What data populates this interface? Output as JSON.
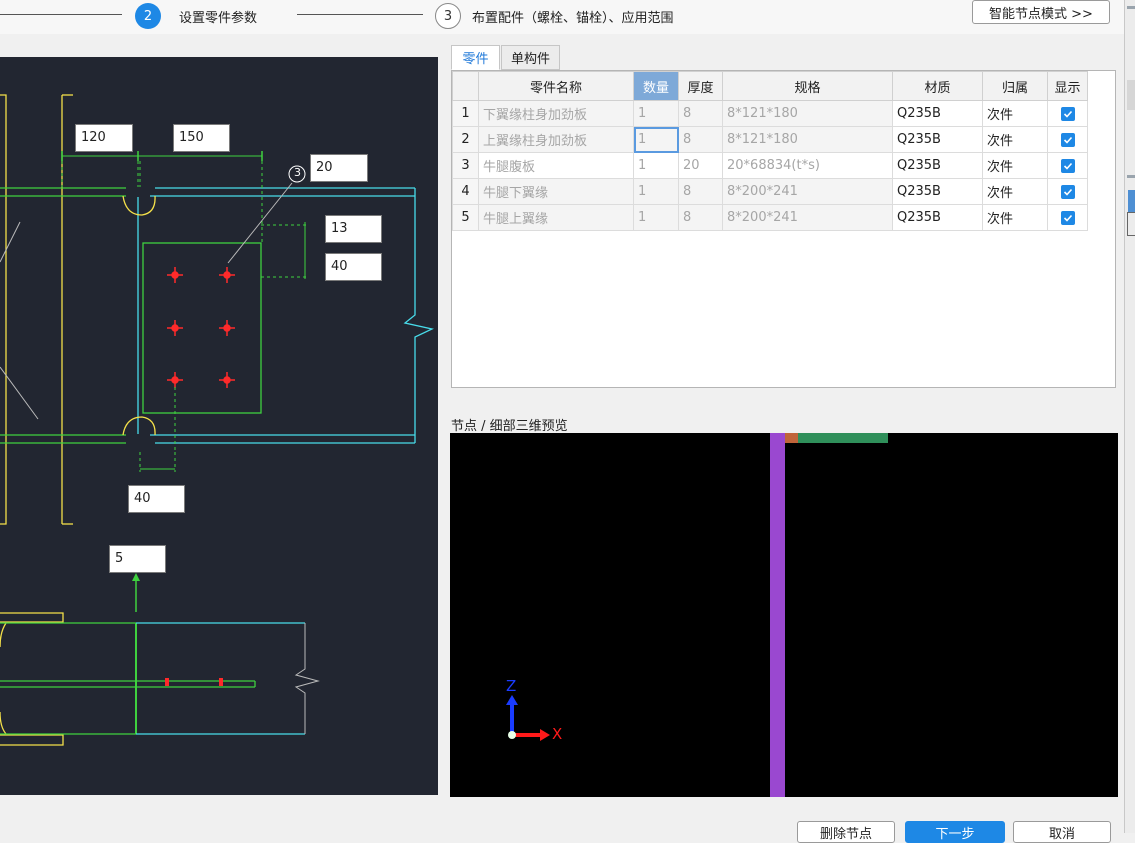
{
  "steps": [
    {
      "number": "2",
      "label": "设置零件参数"
    },
    {
      "number": "3",
      "label": "布置配件（螺栓、锚栓）、应用范围"
    }
  ],
  "smart_mode_button": "智能节点模式 >>",
  "tabs": [
    "零件",
    "单构件"
  ],
  "parts_table": {
    "columns": [
      "零件名称",
      "数量",
      "厚度",
      "规格",
      "材质",
      "归属",
      "显示"
    ],
    "rows": [
      {
        "index": "1",
        "name": "下翼缘柱身加劲板",
        "qty": "1",
        "thickness": "8",
        "spec": "8*121*180",
        "material": "Q235B",
        "owner": "次件",
        "show": true
      },
      {
        "index": "2",
        "name": "上翼缘柱身加劲板",
        "qty": "1",
        "thickness": "8",
        "spec": "8*121*180",
        "material": "Q235B",
        "owner": "次件",
        "show": true
      },
      {
        "index": "3",
        "name": "牛腿腹板",
        "qty": "1",
        "thickness": "20",
        "spec": "20*68834(t*s)",
        "material": "Q235B",
        "owner": "次件",
        "show": true
      },
      {
        "index": "4",
        "name": "牛腿下翼缘",
        "qty": "1",
        "thickness": "8",
        "spec": "8*200*241",
        "material": "Q235B",
        "owner": "次件",
        "show": true
      },
      {
        "index": "5",
        "name": "牛腿上翼缘",
        "qty": "1",
        "thickness": "8",
        "spec": "8*200*241",
        "material": "Q235B",
        "owner": "次件",
        "show": true
      }
    ]
  },
  "cad_dimensions": {
    "d120": "120",
    "d150": "150",
    "d20": "20",
    "d13": "13",
    "d40_right": "40",
    "d40_bottom": "40",
    "d5": "5",
    "part_marker": "3"
  },
  "preview": {
    "label": "节点 / 细部三维预览",
    "axis_z": "Z",
    "axis_x": "X"
  },
  "footer_buttons": [
    "删除节点",
    "下一步",
    "取消"
  ],
  "colors": {
    "accent": "#1e88e5",
    "cad_background": "#222631"
  }
}
